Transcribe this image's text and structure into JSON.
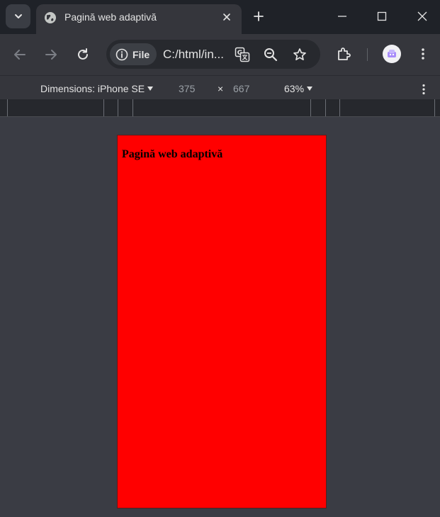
{
  "tab": {
    "title": "Pagină web adaptivă"
  },
  "omnibox": {
    "chip_label": "File",
    "url": "C:/html/in..."
  },
  "device_toolbar": {
    "dimensions_label": "Dimensions: iPhone SE",
    "width": "375",
    "times": "×",
    "height": "667",
    "zoom": "63%"
  },
  "page": {
    "heading": "Pagină web adaptivă",
    "background": "#ff0000"
  },
  "icons": {
    "tab_search": "chevron-down-icon",
    "favicon": "globe-icon",
    "tab_close": "close-icon",
    "new_tab": "plus-icon",
    "minimize": "minimize-icon",
    "maximize": "maximize-icon",
    "window_close": "close-icon",
    "back": "arrow-left-icon",
    "forward": "arrow-right-icon",
    "reload": "reload-icon",
    "site_info": "info-icon",
    "translate": "translate-icon",
    "zoom": "zoom-out-icon",
    "bookmark": "star-icon",
    "extensions": "puzzle-icon",
    "profile": "avatar",
    "menu": "kebab-icon"
  }
}
